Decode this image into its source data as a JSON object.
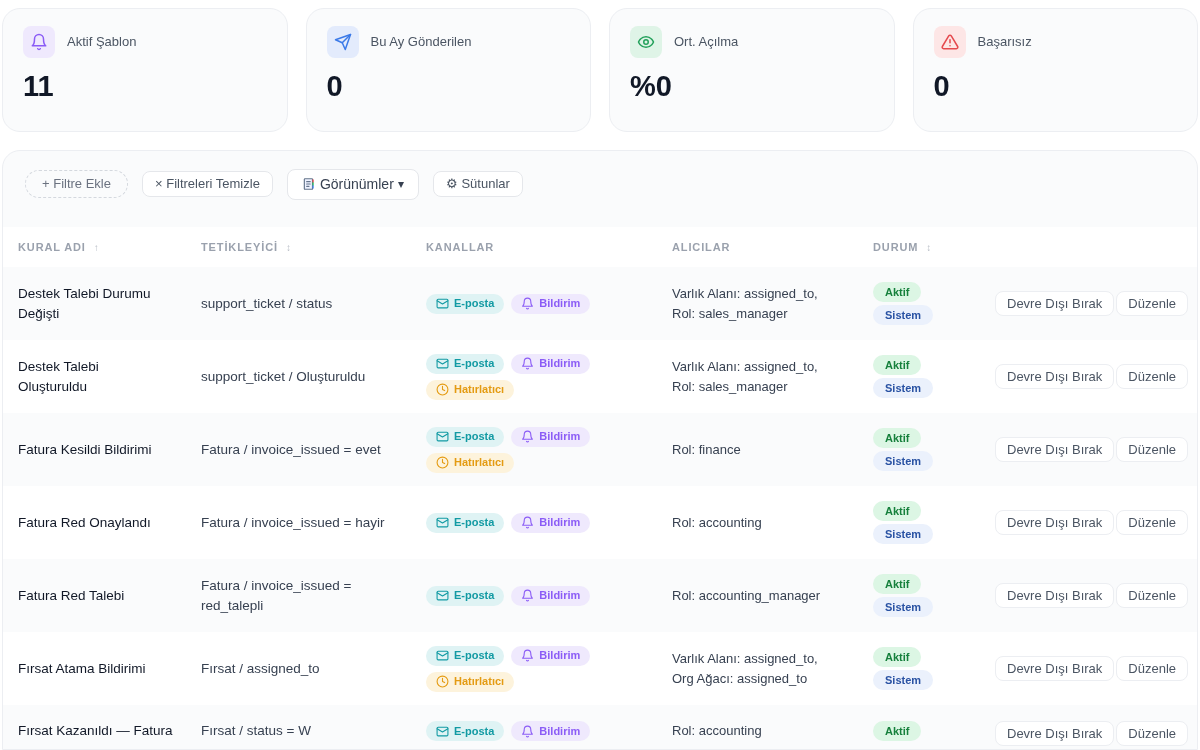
{
  "stats": [
    {
      "kind": "bell",
      "label": "Aktif Şablon",
      "value": "11"
    },
    {
      "kind": "send",
      "label": "Bu Ay Gönderilen",
      "value": "0"
    },
    {
      "kind": "eye",
      "label": "Ort. Açılma",
      "value": "%0"
    },
    {
      "kind": "warning",
      "label": "Başarısız",
      "value": "0"
    }
  ],
  "toolbar": {
    "add_filter": "+ Filtre Ekle",
    "clear_filters": "× Filtreleri Temizle",
    "views": "Görünümler",
    "views_caret": "▾",
    "columns": "⚙ Sütunlar"
  },
  "table": {
    "columns": [
      {
        "label": "KURAL ADI",
        "sort": "↑"
      },
      {
        "label": "TETİKLEYİCİ",
        "sort": "↕"
      },
      {
        "label": "KANALLAR"
      },
      {
        "label": "ALICILAR"
      },
      {
        "label": "DURUM",
        "sort": "↕"
      }
    ],
    "rows": [
      {
        "name": "Destek Talebi Durumu Değişti",
        "trigger": "support_ticket / status",
        "channels": [
          {
            "kind": "email",
            "label": "E-posta"
          },
          {
            "kind": "notification",
            "label": "Bildirim"
          }
        ],
        "recipients": [
          "Varlık Alanı: assigned_to,",
          "Rol: sales_manager"
        ],
        "badges": [
          {
            "kind": "active",
            "label": "Aktif"
          },
          {
            "kind": "system",
            "label": "Sistem"
          }
        ],
        "actions": [
          "Devre Dışı Bırak",
          "Düzenle"
        ]
      },
      {
        "name": "Destek Talebi Oluşturuldu",
        "trigger": "support_ticket / Oluşturuldu",
        "channels": [
          {
            "kind": "email",
            "label": "E-posta"
          },
          {
            "kind": "notification",
            "label": "Bildirim"
          },
          {
            "kind": "reminder",
            "label": "Hatırlatıcı"
          }
        ],
        "recipients": [
          "Varlık Alanı: assigned_to,",
          "Rol: sales_manager"
        ],
        "badges": [
          {
            "kind": "active",
            "label": "Aktif"
          },
          {
            "kind": "system",
            "label": "Sistem"
          }
        ],
        "actions": [
          "Devre Dışı Bırak",
          "Düzenle"
        ]
      },
      {
        "name": "Fatura Kesildi Bildirimi",
        "trigger": "Fatura / invoice_issued = evet",
        "channels": [
          {
            "kind": "email",
            "label": "E-posta"
          },
          {
            "kind": "notification",
            "label": "Bildirim"
          },
          {
            "kind": "reminder",
            "label": "Hatırlatıcı"
          }
        ],
        "recipients": [
          "Rol: finance"
        ],
        "badges": [
          {
            "kind": "active",
            "label": "Aktif"
          },
          {
            "kind": "system",
            "label": "Sistem"
          }
        ],
        "actions": [
          "Devre Dışı Bırak",
          "Düzenle"
        ]
      },
      {
        "name": "Fatura Red Onaylandı",
        "trigger": "Fatura / invoice_issued = hayir",
        "channels": [
          {
            "kind": "email",
            "label": "E-posta"
          },
          {
            "kind": "notification",
            "label": "Bildirim"
          }
        ],
        "recipients": [
          "Rol: accounting"
        ],
        "badges": [
          {
            "kind": "active",
            "label": "Aktif"
          },
          {
            "kind": "system",
            "label": "Sistem"
          }
        ],
        "actions": [
          "Devre Dışı Bırak",
          "Düzenle"
        ]
      },
      {
        "name": "Fatura Red Talebi",
        "trigger": "Fatura / invoice_issued = red_talepli",
        "channels": [
          {
            "kind": "email",
            "label": "E-posta"
          },
          {
            "kind": "notification",
            "label": "Bildirim"
          }
        ],
        "recipients": [
          "Rol: accounting_manager"
        ],
        "badges": [
          {
            "kind": "active",
            "label": "Aktif"
          },
          {
            "kind": "system",
            "label": "Sistem"
          }
        ],
        "actions": [
          "Devre Dışı Bırak",
          "Düzenle"
        ]
      },
      {
        "name": "Fırsat Atama Bildirimi",
        "trigger": "Fırsat / assigned_to",
        "channels": [
          {
            "kind": "email",
            "label": "E-posta"
          },
          {
            "kind": "notification",
            "label": "Bildirim"
          },
          {
            "kind": "reminder",
            "label": "Hatırlatıcı"
          }
        ],
        "recipients": [
          "Varlık Alanı: assigned_to,",
          "Org Ağacı: assigned_to"
        ],
        "badges": [
          {
            "kind": "active",
            "label": "Aktif"
          },
          {
            "kind": "system",
            "label": "Sistem"
          }
        ],
        "actions": [
          "Devre Dışı Bırak",
          "Düzenle"
        ]
      },
      {
        "name": "Fırsat Kazanıldı — Fatura",
        "trigger": "Fırsat / status = W",
        "channels": [
          {
            "kind": "email",
            "label": "E-posta"
          },
          {
            "kind": "notification",
            "label": "Bildirim"
          }
        ],
        "recipients": [
          "Rol: accounting"
        ],
        "badges": [
          {
            "kind": "active",
            "label": "Aktif"
          }
        ],
        "actions": [
          "Devre Dışı Bırak",
          "Düzenle"
        ]
      }
    ]
  }
}
